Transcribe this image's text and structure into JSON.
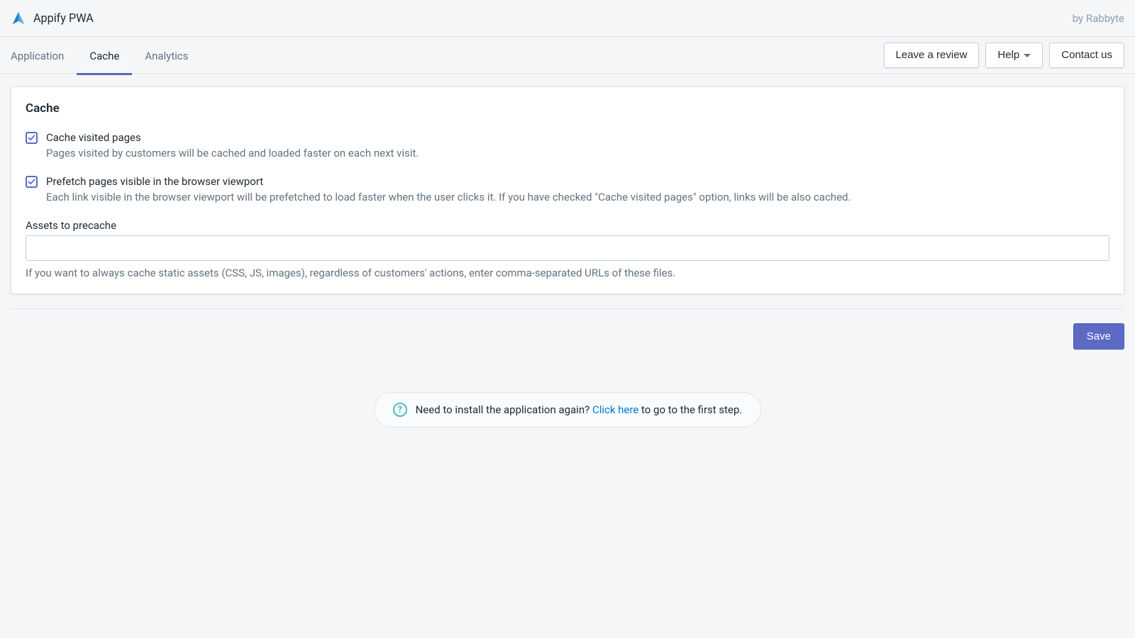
{
  "header": {
    "app_title": "Appify PWA",
    "byline": "by Rabbyte"
  },
  "tabs": [
    {
      "label": "Application",
      "active": false
    },
    {
      "label": "Cache",
      "active": true
    },
    {
      "label": "Analytics",
      "active": false
    }
  ],
  "nav_buttons": {
    "review": "Leave a review",
    "help": "Help",
    "contact": "Contact us"
  },
  "card": {
    "title": "Cache",
    "options": [
      {
        "checked": true,
        "label": "Cache visited pages",
        "help": "Pages visited by customers will be cached and loaded faster on each next visit."
      },
      {
        "checked": true,
        "label": "Prefetch pages visible in the browser viewport",
        "help": "Each link visible in the browser viewport will be prefetched to load faster when the user clicks it. If you have checked \"Cache visited pages\" option, links will be also cached."
      }
    ],
    "precache_field": {
      "label": "Assets to precache",
      "value": "",
      "help": "If you want to always cache static assets (CSS, JS, images), regardless of customers' actions, enter comma-separated URLs of these files."
    }
  },
  "save_label": "Save",
  "reinstall": {
    "prefix": "Need to install the application again? ",
    "link": "Click here",
    "suffix": " to go to the first step."
  }
}
